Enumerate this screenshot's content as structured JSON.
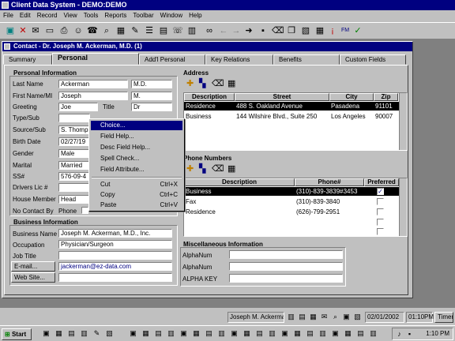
{
  "app": {
    "title": "Client Data System - DEMO:DEMO"
  },
  "menu": [
    "File",
    "Edit",
    "Record",
    "View",
    "Tools",
    "Reports",
    "Toolbar",
    "Window",
    "Help"
  ],
  "toolbar": {
    "icons": [
      "client-icon",
      "delete-icon",
      "mail-icon",
      "card-icon",
      "print-icon",
      "contact-icon",
      "phone-icon",
      "search-icon",
      "calendar-icon",
      "note-icon",
      "list-icon",
      "report-icon",
      "fax-icon",
      "chart-icon",
      "binoculars-icon",
      "back-icon",
      "forward-icon",
      "next-icon",
      "save-icon",
      "trash-icon",
      "copy-icon",
      "paste-icon",
      "grid-icon",
      "attach-icon",
      "form-icon",
      "ok-icon"
    ]
  },
  "window": {
    "title": "Contact - Dr. Joseph M. Ackerman, M.D. (1)"
  },
  "tabs": [
    "Summary",
    "Personal",
    "Add'l Personal",
    "Key Relations",
    "Benefits",
    "Custom Fields"
  ],
  "personal": {
    "heading": "Personal Information",
    "last_name_label": "Last Name",
    "last_name": "Ackerman",
    "suffix": "M.D.",
    "first_name_label": "First Name/MI",
    "first_name": "Joseph",
    "mi": "M.",
    "greeting_label": "Greeting",
    "greeting": "Joe",
    "title_label": "Title",
    "title": "Dr",
    "type_label": "Type/Sub",
    "source_label": "Source/Sub",
    "source": "S. Thomp",
    "birth_label": "Birth Date",
    "birth": "02/27/19",
    "gender_label": "Gender",
    "gender": "Male",
    "marital_label": "Marital",
    "marital": "Married",
    "ssn_label": "SS#",
    "ssn": "576-09-4",
    "drivers_label": "Drivers Lic #",
    "house_label": "House Member",
    "house": "Head",
    "nocontact_label": "No Contact By",
    "nocontact": "Phone"
  },
  "business": {
    "heading": "Business Information",
    "name_label": "Business Name",
    "name": "Joseph M. Ackerman, M.D., Inc.",
    "occupation_label": "Occupation",
    "occupation": "Physician/Surgeon",
    "jobtitle_label": "Job Title",
    "email_button": "E-mail...",
    "email": "jackerman@ez-data.com",
    "web_button": "Web Site..."
  },
  "address": {
    "heading": "Address",
    "columns": [
      "Description",
      "Street",
      "City",
      "Zip"
    ],
    "rows": [
      [
        "Residence",
        "488 S. Oakland Avenue",
        "Pasadena",
        "91101"
      ],
      [
        "Business",
        "144 Wilshire Blvd., Suite 250",
        "Los Angeles",
        "90007"
      ]
    ]
  },
  "phones": {
    "heading": "Phone Numbers",
    "columns": [
      "Description",
      "Phone#",
      "Preferred"
    ],
    "rows": [
      [
        "Business",
        "(310)-839-3839#3453",
        "checked"
      ],
      [
        "Fax",
        "(310)-839-3840",
        ""
      ],
      [
        "Residence",
        "(626)-799-2951",
        ""
      ]
    ]
  },
  "misc": {
    "heading": "Miscellaneous Information",
    "labels": [
      "AlphaNum",
      "AlphaNum",
      "ALPHA KEY"
    ]
  },
  "context_menu": {
    "items": [
      {
        "label": "Choice...",
        "shortcut": ""
      },
      {
        "label": "Field Help...",
        "shortcut": ""
      },
      {
        "label": "Desc Field Help...",
        "shortcut": ""
      },
      {
        "label": "Spell Check...",
        "shortcut": ""
      },
      {
        "label": "Field Attribute...",
        "shortcut": ""
      },
      {
        "label": "Cut",
        "shortcut": "Ctrl+X"
      },
      {
        "label": "Copy",
        "shortcut": "Ctrl+C"
      },
      {
        "label": "Paste",
        "shortcut": "Ctrl+V"
      }
    ]
  },
  "statusbar": {
    "contact": "Joseph M. Ackerma",
    "date": "02/01/2002",
    "time": "01:10PM",
    "timer": "Timer"
  },
  "taskbar": {
    "start": "Start",
    "clock": "1:10 PM"
  },
  "colors": {
    "title": "#000080",
    "face": "#c0c0c0",
    "desktop": "#808080",
    "selection": "#000000"
  }
}
